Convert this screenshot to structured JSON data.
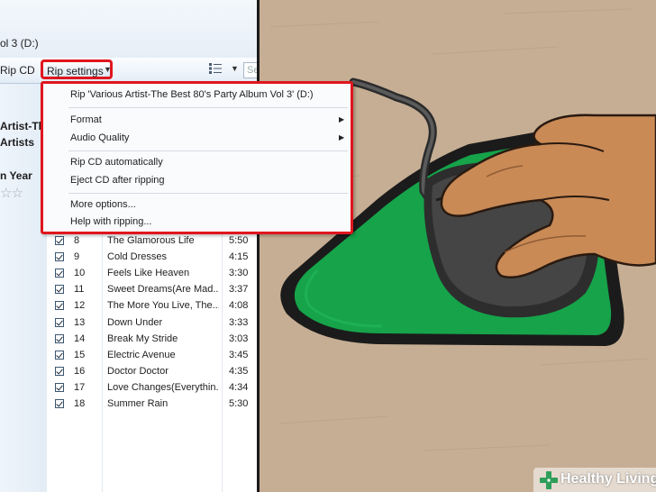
{
  "window": {
    "title": "ol 3 (D:)"
  },
  "toolbar": {
    "rip_cd_label": "Rip CD",
    "rip_settings_label": "Rip settings",
    "search_placeholder": "Se"
  },
  "info_panel": {
    "album_artist": "Artist-The",
    "album_artists": "Artists",
    "year_label": "n Year",
    "rating_stars": "☆☆"
  },
  "menu": {
    "items": [
      {
        "label": "Rip 'Various Artist-The Best 80's Party Album Vol 3' (D:)",
        "submenu": false
      },
      {
        "label": "Format",
        "submenu": true
      },
      {
        "label": "Audio Quality",
        "submenu": true
      },
      {
        "label": "Rip CD automatically",
        "submenu": false
      },
      {
        "label": "Eject CD after ripping",
        "submenu": false
      },
      {
        "label": "More options...",
        "submenu": false
      },
      {
        "label": "Help with ripping...",
        "submenu": false
      }
    ]
  },
  "tracks": [
    {
      "num": "8",
      "title": "The Glamorous Life",
      "length": "5:50"
    },
    {
      "num": "9",
      "title": "Cold Dresses",
      "length": "4:15"
    },
    {
      "num": "10",
      "title": "Feels Like Heaven",
      "length": "3:30"
    },
    {
      "num": "11",
      "title": "Sweet Dreams(Are Mad...",
      "length": "3:37"
    },
    {
      "num": "12",
      "title": "The More You Live, The...",
      "length": "4:08"
    },
    {
      "num": "13",
      "title": "Down Under",
      "length": "3:33"
    },
    {
      "num": "14",
      "title": "Break My Stride",
      "length": "3:03"
    },
    {
      "num": "15",
      "title": "Electric Avenue",
      "length": "3:45"
    },
    {
      "num": "16",
      "title": "Doctor Doctor",
      "length": "4:35"
    },
    {
      "num": "17",
      "title": "Love Changes(Everythin...",
      "length": "4:34"
    },
    {
      "num": "18",
      "title": "Summer Rain",
      "length": "5:30"
    }
  ],
  "watermark": {
    "brand": "Healthy Living"
  },
  "icons": {
    "dropdown_arrow": "chevron-down-icon",
    "submenu_arrow": "chevron-right-icon",
    "view_options": "view-options-icon",
    "logo": "healthy-living-logo-icon"
  },
  "colors": {
    "highlight_border": "#e0161e",
    "mousepad_green": "#16a34a",
    "mousepad_edge": "#1b1b1b",
    "mouse_body": "#3f3f3f",
    "hand_skin": "#c98a56",
    "desk": "#c5ad93"
  }
}
